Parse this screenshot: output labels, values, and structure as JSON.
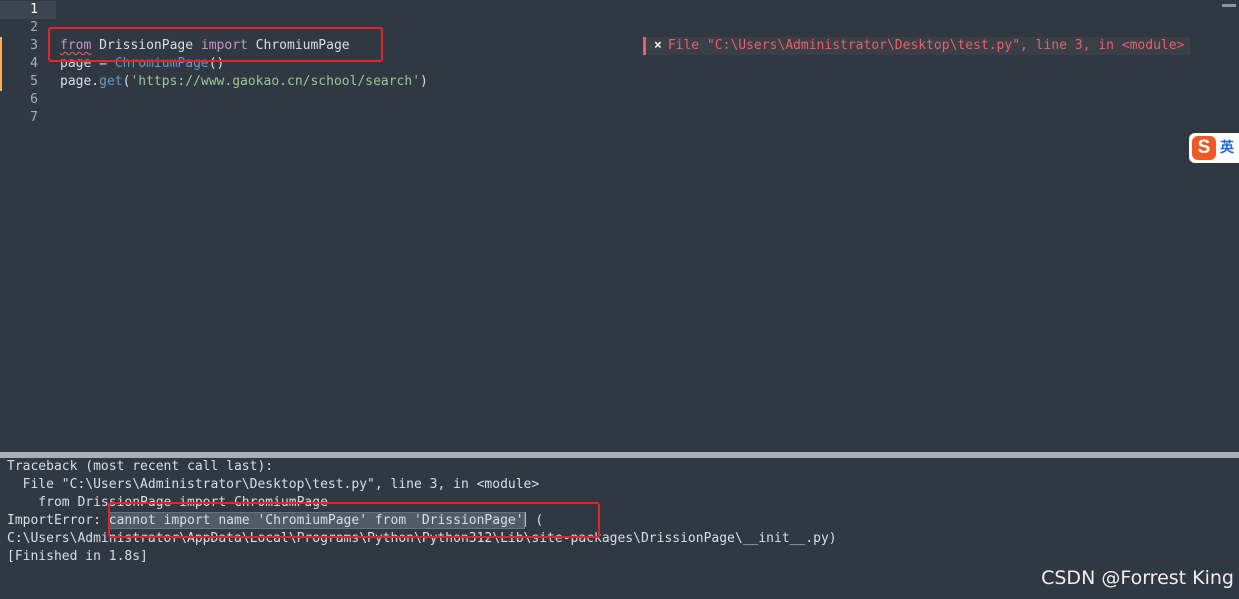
{
  "editor": {
    "line_numbers": [
      "1",
      "2",
      "3",
      "4",
      "5",
      "6",
      "7"
    ],
    "line3": {
      "kw_from": "from",
      "module": " DrissionPage ",
      "kw_import": "import",
      "name": " ChromiumPage"
    },
    "line4": {
      "var": "page = ",
      "call": "ChromiumPage",
      "parens": "()"
    },
    "line5": {
      "obj": "page.",
      "method": "get",
      "open": "(",
      "url": "'https://www.gaokao.cn/school/search'",
      "close": ")"
    },
    "error_phantom": {
      "icon": "×",
      "text": "File \"C:\\Users\\Administrator\\Desktop\\test.py\", line 3, in <module>"
    }
  },
  "ime": {
    "logo": "S",
    "mode": "英"
  },
  "output": {
    "line1": "Traceback (most recent call last):",
    "line2": "  File \"C:\\Users\\Administrator\\Desktop\\test.py\", line 3, in <module>",
    "line3": "    from DrissionPage import ChromiumPage",
    "line4_prefix": "ImportError: ",
    "line4_selected": "cannot import name 'ChromiumPage' from 'DrissionPage'",
    "line4_suffix": " (",
    "line5": "C:\\Users\\Administrator\\AppData\\Local\\Programs\\Python\\Python312\\Lib\\site-packages\\DrissionPage\\__init__.py)",
    "line6": "[Finished in 1.8s]"
  },
  "watermark": "CSDN @Forrest King",
  "colors": {
    "background": "#303841",
    "keyword": "#c695c6",
    "function": "#6699cc",
    "string": "#99c794",
    "error": "#ec5f67",
    "annotation_box": "#e8222b"
  }
}
